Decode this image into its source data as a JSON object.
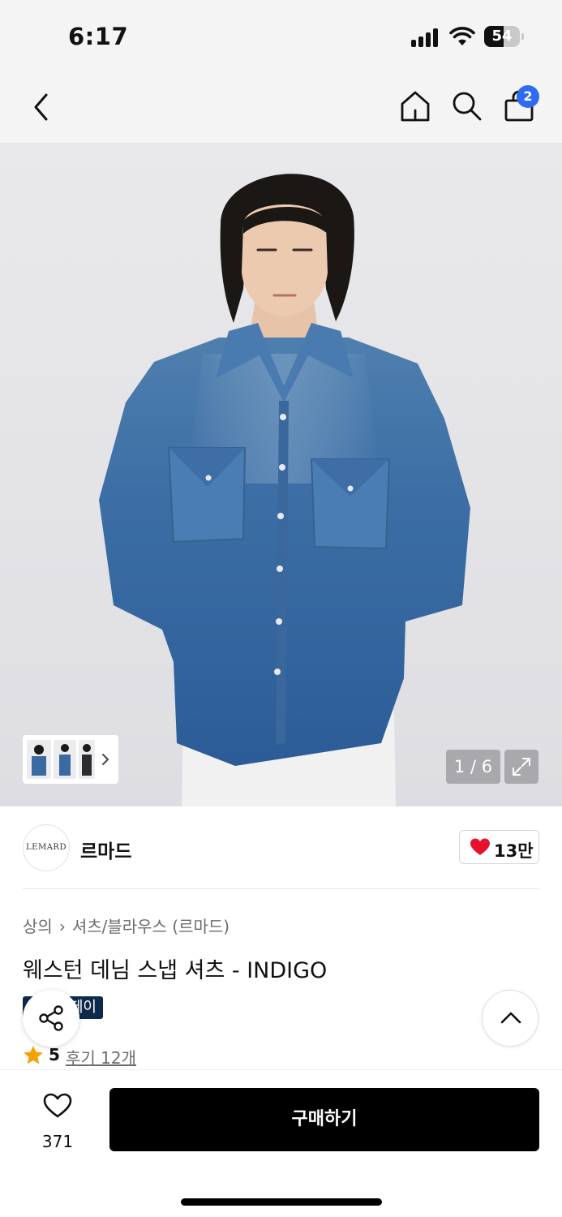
{
  "status": {
    "time": "6:17",
    "battery": "54",
    "battery_level": 0.54
  },
  "nav": {
    "back_icon": "chevron-left-icon",
    "home_icon": "home-icon",
    "search_icon": "search-icon",
    "cart_icon": "shopping-bag-icon",
    "cart_count": "2",
    "cart_badge_color": "#2f6bf0"
  },
  "gallery": {
    "counter": "1 / 6",
    "thumbnail_count": 3,
    "expand_icon": "expand-icon"
  },
  "brand": {
    "logo_text": "LEMARD",
    "name": "르마드",
    "likes": "13만",
    "heart_color": "#e8112d"
  },
  "product": {
    "breadcrumb": [
      "상의",
      "셔츠/블라우스 (르마드)"
    ],
    "title": "웨스턴 데님 스냅 셔츠 - INDIGO",
    "promo_badge": "페이",
    "rating": "5",
    "reviews": "후기 12개",
    "star_color": "#f5a100"
  },
  "actions": {
    "wish_count": "371",
    "buy_label": "구매하기"
  }
}
